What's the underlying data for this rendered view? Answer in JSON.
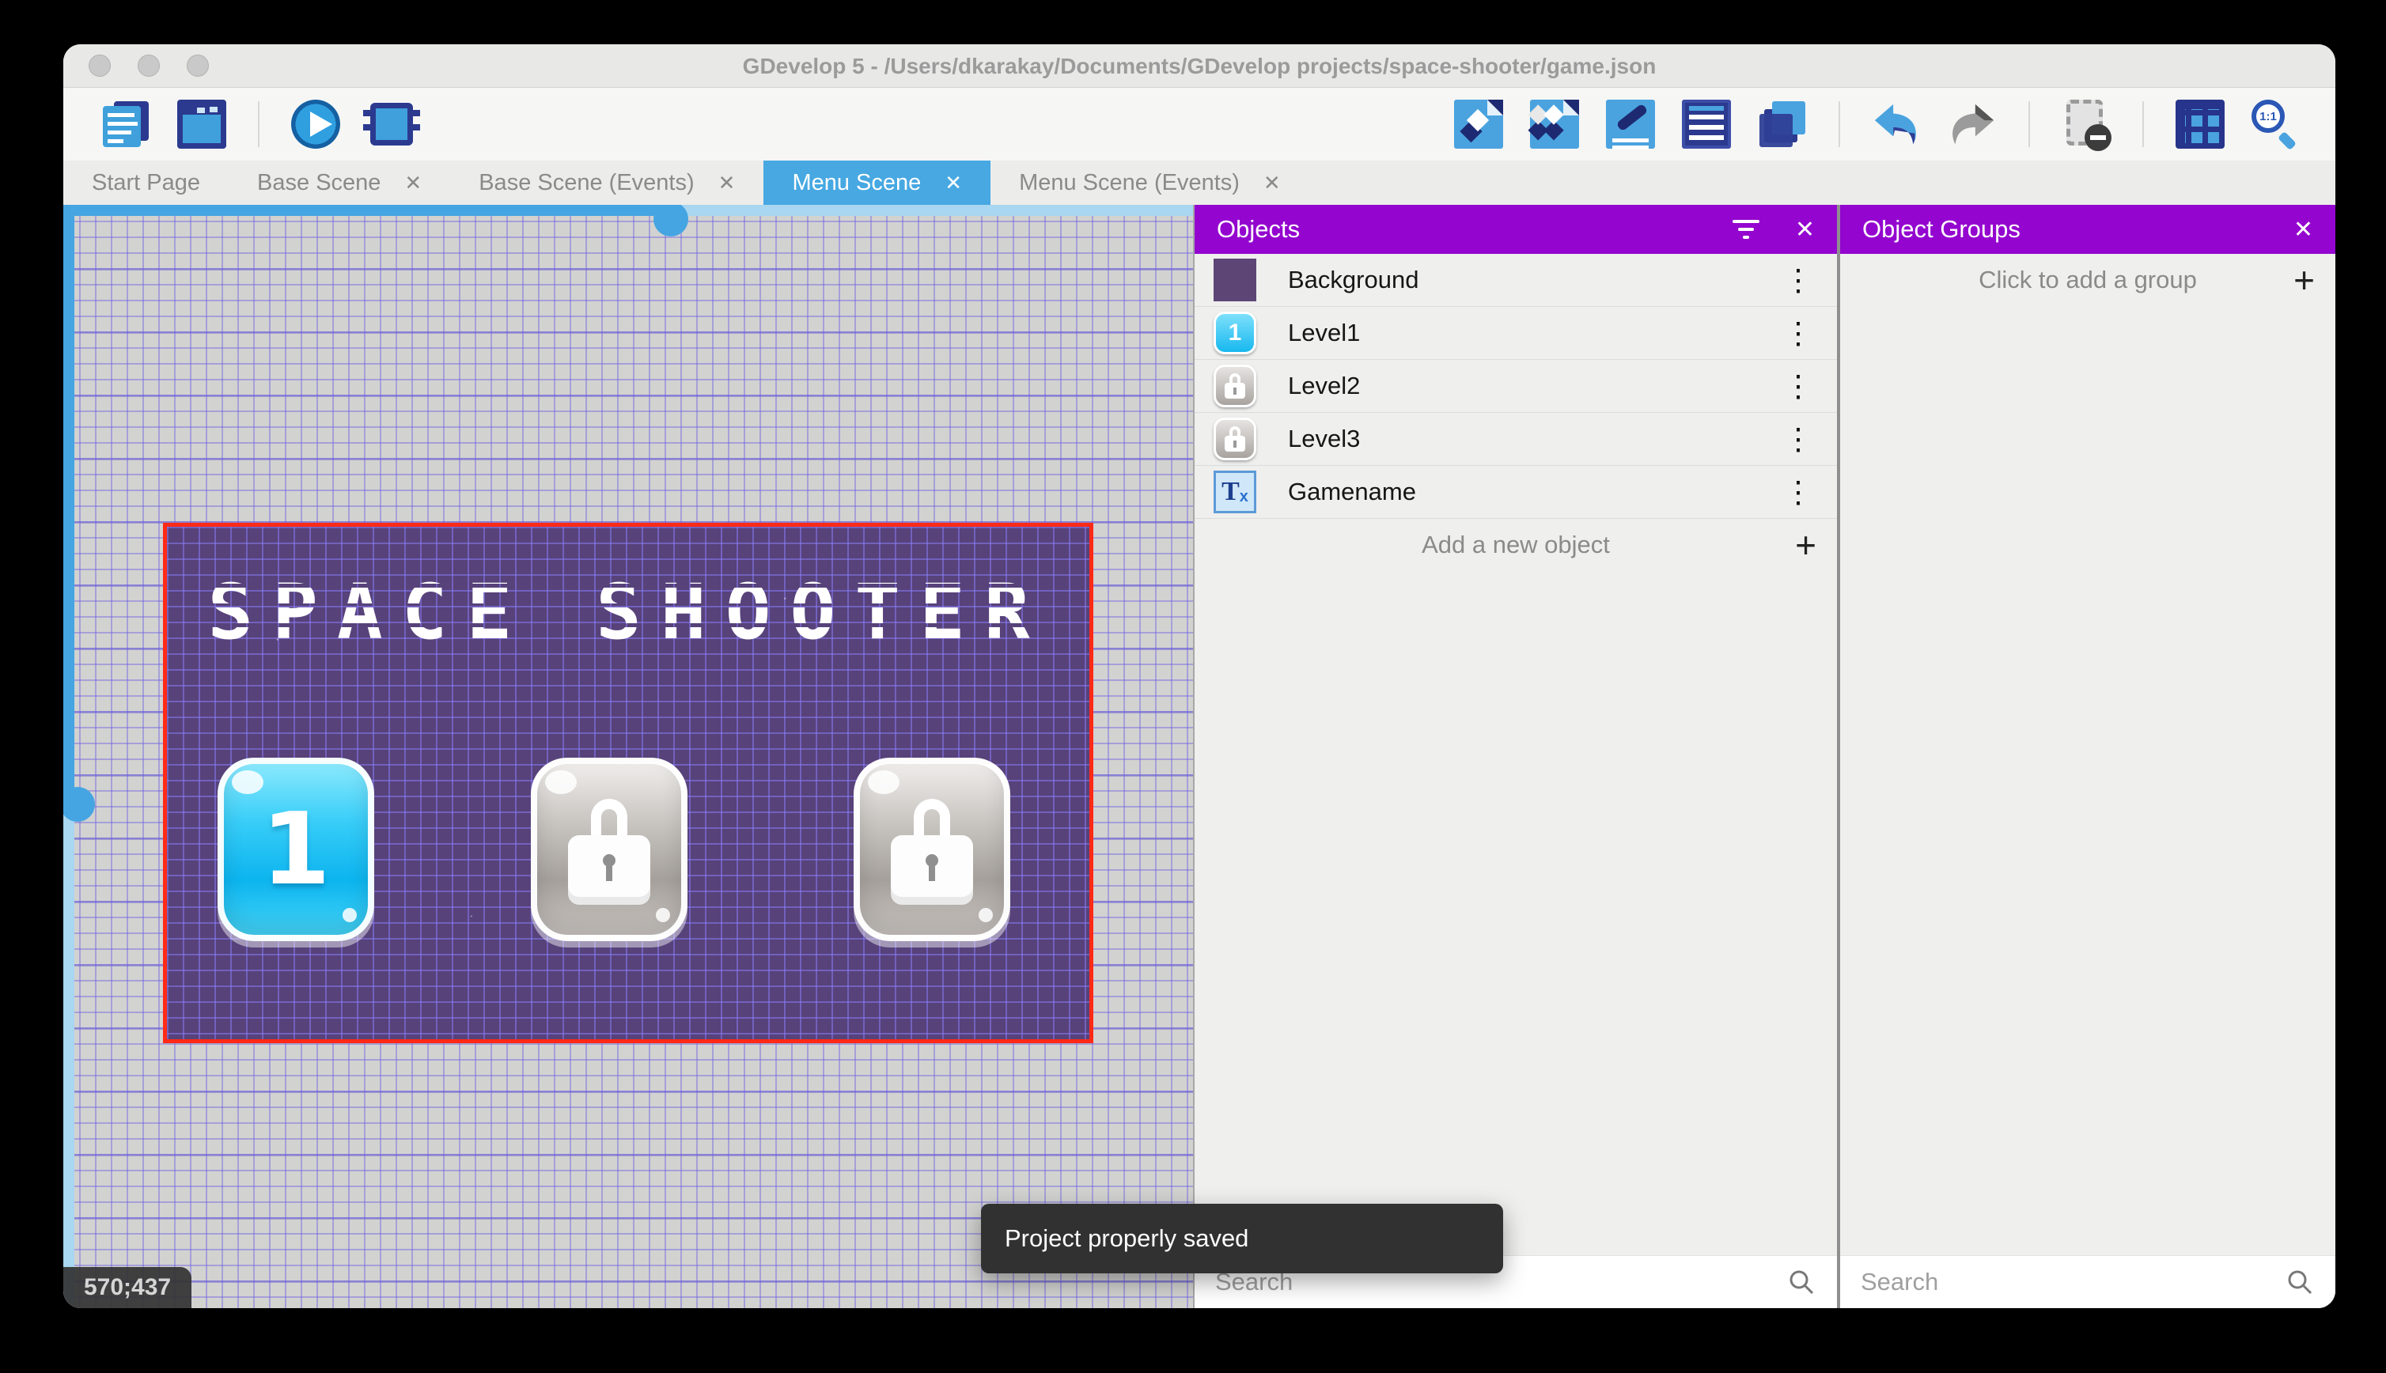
{
  "window": {
    "title": "GDevelop 5 - /Users/dkarakay/Documents/GDevelop projects/space-shooter/game.json"
  },
  "toolbar": {
    "left_icons": [
      "project-manager",
      "scene-editor-window",
      "start-preview",
      "debug"
    ],
    "right_icons": [
      "objects-editor",
      "object-groups-editor",
      "properties",
      "instances-list",
      "layers-editor",
      "undo",
      "redo",
      "toggle-mask",
      "toggle-grid",
      "zoom-original"
    ]
  },
  "tabs": [
    {
      "label": "Start Page",
      "closable": false,
      "active": false
    },
    {
      "label": "Base Scene",
      "closable": true,
      "active": false
    },
    {
      "label": "Base Scene (Events)",
      "closable": true,
      "active": false
    },
    {
      "label": "Menu Scene",
      "closable": true,
      "active": true
    },
    {
      "label": "Menu Scene (Events)",
      "closable": true,
      "active": false
    }
  ],
  "scene": {
    "title": "SPACE SHOOTER",
    "level_buttons": [
      {
        "label": "1",
        "state": "unlocked"
      },
      {
        "label": "",
        "state": "locked"
      },
      {
        "label": "",
        "state": "locked"
      }
    ]
  },
  "status": {
    "coordinates": "570;437"
  },
  "toast": {
    "message": "Project properly saved"
  },
  "objects_panel": {
    "title": "Objects",
    "items": [
      {
        "name": "Background",
        "icon": "background-thumbnail"
      },
      {
        "name": "Level1",
        "icon": "level1-button-thumbnail"
      },
      {
        "name": "Level2",
        "icon": "locked-button-thumbnail"
      },
      {
        "name": "Level3",
        "icon": "locked-button-thumbnail"
      },
      {
        "name": "Gamename",
        "icon": "text-object-thumbnail"
      }
    ],
    "add_label": "Add a new object",
    "search_placeholder": "Search"
  },
  "groups_panel": {
    "title": "Object Groups",
    "add_label": "Click to add a group",
    "search_placeholder": "Search"
  },
  "glyphs": {
    "tab_close": "✕",
    "panel_close": "✕",
    "kebab": "⋮",
    "plus": "+"
  },
  "colors": {
    "accent_blue": "#47a8e2",
    "panel_purple": "#9406cf",
    "selection_red": "#ff2a16",
    "scene_purple": "#57427a",
    "toast_gray": "#313131"
  }
}
